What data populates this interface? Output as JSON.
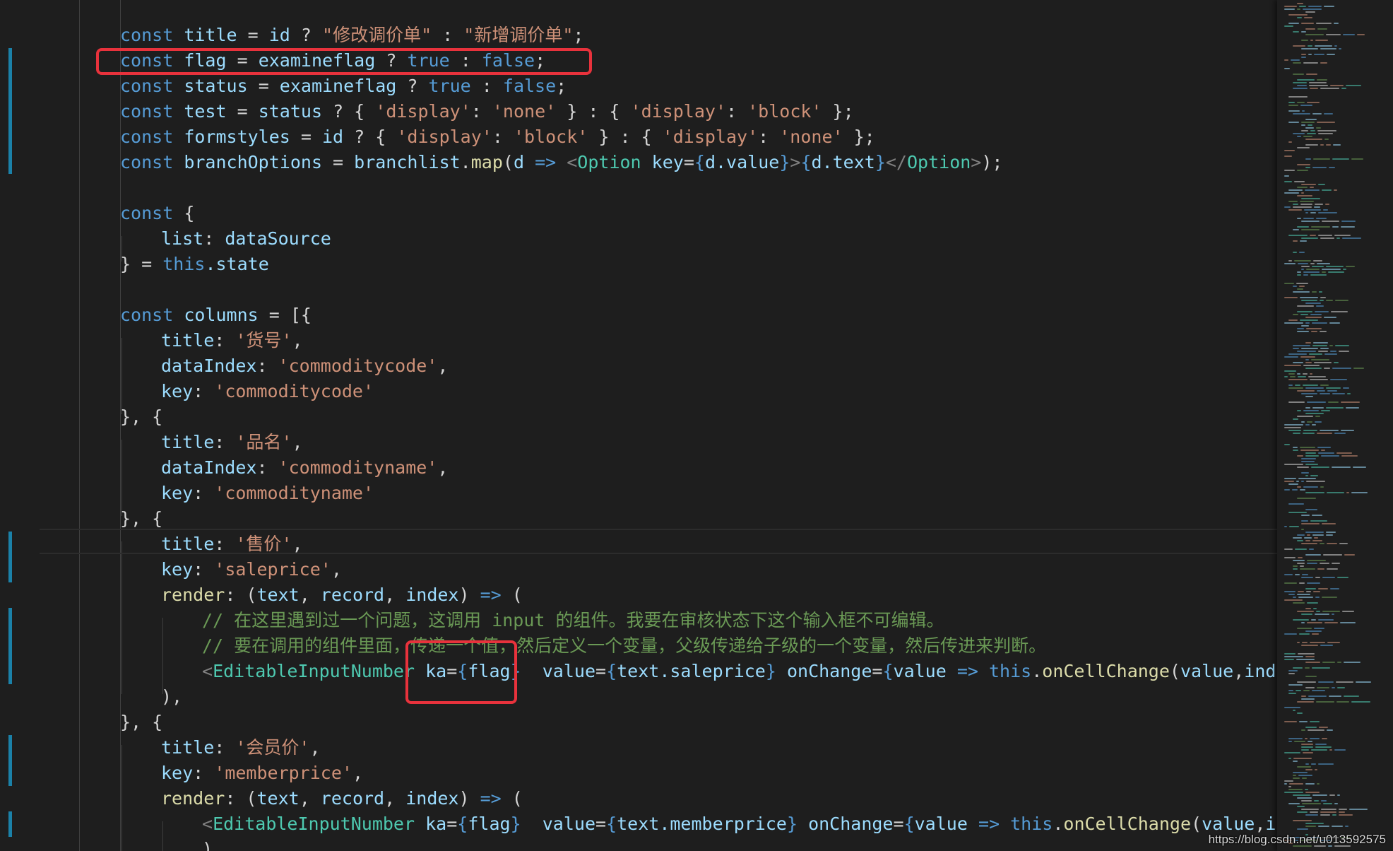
{
  "code": {
    "l1": {
      "kw": "const",
      "n": "title",
      "eq": " = ",
      "v": "id",
      "q": " ? ",
      "s1": "\"修改调价单\"",
      "c": " : ",
      "s2": "\"新增调价单\"",
      "e": ";"
    },
    "l2": {
      "kw": "const",
      "n": "flag",
      "eq": " = ",
      "v": "examineflag",
      "q": " ? ",
      "t": "true",
      "c": " : ",
      "f": "false",
      "e": ";"
    },
    "l3": {
      "kw": "const",
      "n": "status",
      "eq": " = ",
      "v": "examineflag",
      "q": " ? ",
      "t": "true",
      "c": " : ",
      "f": "false",
      "e": ";"
    },
    "l4": {
      "kw": "const",
      "n": "test",
      "eq": " = ",
      "v": "status",
      "q": " ? { ",
      "k1": "'display'",
      "c1": ": ",
      "v1": "'none'",
      "m": " } : { ",
      "k2": "'display'",
      "c2": ": ",
      "v2": "'block'",
      "e": " };"
    },
    "l5": {
      "kw": "const",
      "n": "formstyles",
      "eq": " = ",
      "v": "id",
      "q": " ? { ",
      "k1": "'display'",
      "c1": ": ",
      "v1": "'block'",
      "m": " } : { ",
      "k2": "'display'",
      "c2": ": ",
      "v2": "'none'",
      "e": " };"
    },
    "l6": {
      "kw": "const",
      "n": "branchOptions",
      "eq": " = ",
      "obj": "branchlist",
      "dot": ".",
      "fn": "map",
      "op": "(",
      "param": "d",
      "arrow": " => ",
      "lt": "<",
      "tag": "Option",
      "attr": " key",
      "as": "=",
      "b1": "{",
      "e1": "d.value",
      "b2": "}",
      "gt": ">",
      "b3": "{",
      "e2": "d.text",
      "b4": "}",
      "close": "</",
      "tag2": "Option",
      "gt2": ">",
      "end": ");"
    },
    "l8": {
      "kw": "const",
      "b": " {"
    },
    "l9": {
      "prop": "list",
      "c": ": ",
      "v": "dataSource"
    },
    "l10": {
      "b": "} = ",
      "this": "this",
      "rest": ".state"
    },
    "l12": {
      "kw": "const",
      "n": "columns",
      "rest": " = [{"
    },
    "l13": {
      "p": "title",
      "c": ": ",
      "s": "'货号'",
      "e": ","
    },
    "l14": {
      "p": "dataIndex",
      "c": ": ",
      "s": "'commoditycode'",
      "e": ","
    },
    "l15": {
      "p": "key",
      "c": ": ",
      "s": "'commoditycode'"
    },
    "l16": {
      "b": "}, {"
    },
    "l17": {
      "p": "title",
      "c": ": ",
      "s": "'品名'",
      "e": ","
    },
    "l18": {
      "p": "dataIndex",
      "c": ": ",
      "s": "'commodityname'",
      "e": ","
    },
    "l19": {
      "p": "key",
      "c": ": ",
      "s": "'commodityname'"
    },
    "l20": {
      "b": "}, {"
    },
    "l21": {
      "p": "title",
      "c": ": ",
      "s": "'售价'",
      "e": ","
    },
    "l22": {
      "p": "key",
      "c": ": ",
      "s": "'saleprice'",
      "e": ","
    },
    "l23": {
      "p": "render",
      "c": ": (",
      "a1": "text",
      "cm1": ", ",
      "a2": "record",
      "cm2": ", ",
      "a3": "index",
      "cp": ")",
      "arrow": " => ",
      "e": "("
    },
    "l24": {
      "comment": "// 在这里遇到过一个问题，这调用 input 的组件。我要在审核状态下这个输入框不可编辑。"
    },
    "l25": {
      "comment": "// 要在调用的组件里面，传递一个值，然后定义一个变量，父级传递给子级的一个变量，然后传进来判断。"
    },
    "l26": {
      "lt": "<",
      "tag": "EditableInputNumber",
      "sp": " ",
      "a1": "ka",
      "eq1": "=",
      "b1": "{",
      "v1": "flag",
      "b2": "}",
      "sp2": "  ",
      "a2": "value",
      "eq2": "=",
      "b3": "{",
      "v2": "text.saleprice",
      "b4": "}",
      "sp3": " ",
      "a3": "onChange",
      "eq3": "=",
      "b5": "{",
      "v3": "value",
      "arrow": " => ",
      "this": "this",
      "dot": ".",
      "fn": "onCellChange",
      "op": "(",
      "x1": "value",
      "cm": ",",
      "x2": "index",
      "tail": ", '"
    },
    "l27": {
      "b": "),"
    },
    "l28": {
      "b": "}, {"
    },
    "l29": {
      "p": "title",
      "c": ": ",
      "s": "'会员价'",
      "e": ","
    },
    "l30": {
      "p": "key",
      "c": ": ",
      "s": "'memberprice'",
      "e": ","
    },
    "l31": {
      "p": "render",
      "c": ": (",
      "a1": "text",
      "cm1": ", ",
      "a2": "record",
      "cm2": ", ",
      "a3": "index",
      "cp": ")",
      "arrow": " => ",
      "e": "("
    },
    "l32": {
      "lt": "<",
      "tag": "EditableInputNumber",
      "sp": " ",
      "a1": "ka",
      "eq1": "=",
      "b1": "{",
      "v1": "flag",
      "b2": "}",
      "sp2": "  ",
      "a2": "value",
      "eq2": "=",
      "b3": "{",
      "v2": "text.memberprice",
      "b4": "}",
      "sp3": " ",
      "a3": "onChange",
      "eq3": "=",
      "b5": "{",
      "v3": "value",
      "arrow": " => ",
      "this": "this",
      "dot": ".",
      "fn": "onCellChange",
      "op": "(",
      "x1": "value",
      "cm": ",",
      "x2": "index",
      "tail": ","
    },
    "l33": {
      "b": ")"
    }
  },
  "watermark": "https://blog.csdn.net/u013592575",
  "colors": {
    "background": "#1e1e1e",
    "keyword": "#569cd6",
    "variable": "#9cdcfe",
    "string": "#ce9178",
    "function": "#dcdcaa",
    "type": "#4ec9b0",
    "comment": "#6a9955",
    "highlight_box": "#e8323c"
  }
}
